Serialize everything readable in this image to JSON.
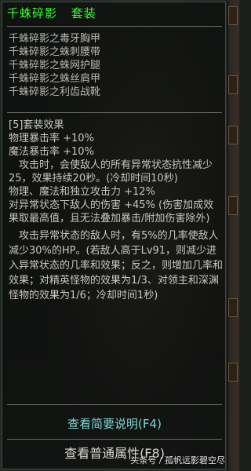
{
  "tooltip": {
    "set_name": "千蛛碎影",
    "set_label": "套装",
    "items": [
      "千蛛碎影之毒牙胸甲",
      "千蛛碎影之蛛刺腰带",
      "千蛛碎影之蛛网护腿",
      "千蛛碎影之蛛丝肩甲",
      "千蛛碎影之利齿战靴"
    ],
    "effects": {
      "header": "[5]套装效果",
      "lines": [
        "物理暴击率 +10%",
        "魔法暴击率 +10%",
        "　攻击时，会使敌人的所有异常状态抗性减少25，效果持续20秒。(冷却时间10秒)",
        "物理、魔法和独立攻击力 +12%",
        "对异常状态下敌人的伤害 +45% (伤害加成效果取最高值，且无法叠加暴击/附加伤害除外)"
      ]
    },
    "abnormal_desc": "　攻击异常状态的敌人时，有5%的几率使敌人减少30%的HP。(若敌人高于Lv91，则减少进入异常状态的几率和效果；反之，则增加几率和效果；对精英怪物的效果为1/3、对领主和深渊怪物的效果为1/6；冷却时间1秒)",
    "buttons": {
      "summary": "查看简要说明(F4)",
      "normal": "查看普通属性(F8)"
    }
  },
  "watermark": "头条号 / 孤帆远影碧空尽",
  "colors": {
    "set_title": "#33ff33",
    "item_text": "#b8b8b0",
    "summary_button": "#7fd7d0"
  }
}
